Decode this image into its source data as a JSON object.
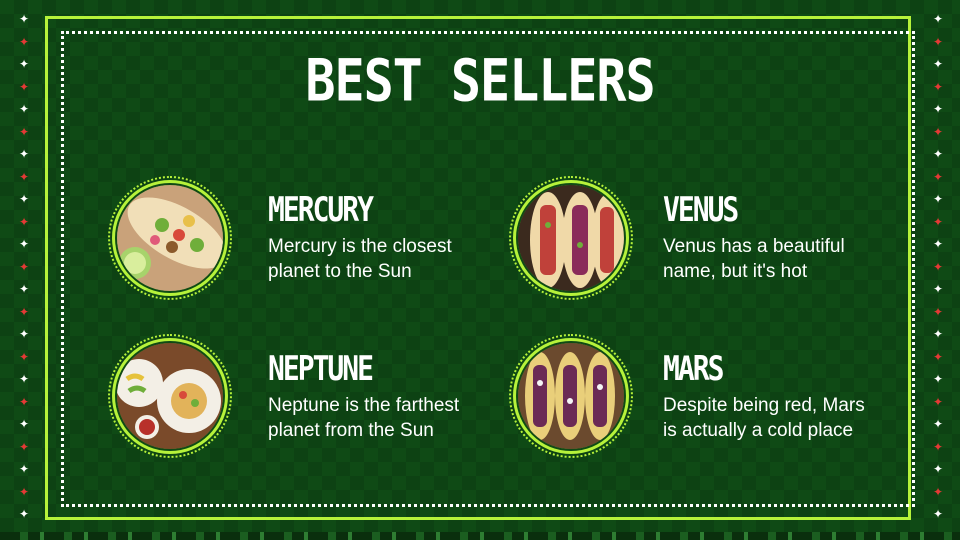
{
  "slide": {
    "title": "BEST SELLERS"
  },
  "items": [
    {
      "name": "MERCURY",
      "description": "Mercury is the closest planet to the Sun"
    },
    {
      "name": "VENUS",
      "description": "Venus has a beautiful name, but it's hot"
    },
    {
      "name": "NEPTUNE",
      "description": "Neptune is the farthest planet from the Sun"
    },
    {
      "name": "MARS",
      "description": "Despite being red, Mars is actually a cold place"
    }
  ],
  "colors": {
    "background": "#0f4a15",
    "accent": "#b6f23a",
    "text": "#ffffff",
    "star_red": "#e53935"
  },
  "icons": {
    "border_star": "four-point-star-icon"
  }
}
